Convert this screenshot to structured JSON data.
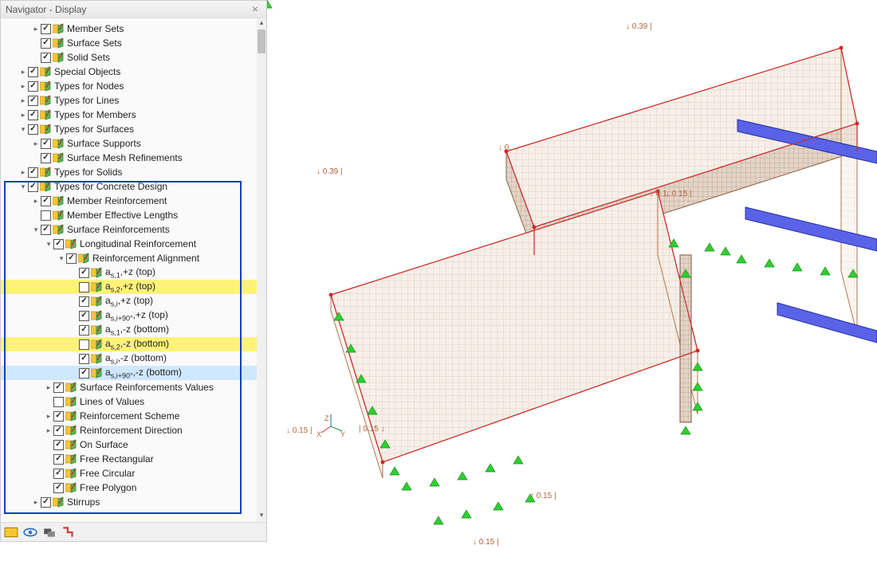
{
  "navigator": {
    "title": "Navigator - Display",
    "tree": [
      {
        "indent": 2,
        "chev": "r",
        "checked": true,
        "label": "Member Sets"
      },
      {
        "indent": 2,
        "chev": "",
        "checked": true,
        "label": "Surface Sets"
      },
      {
        "indent": 2,
        "chev": "",
        "checked": true,
        "label": "Solid Sets"
      },
      {
        "indent": 1,
        "chev": "r",
        "checked": true,
        "label": "Special Objects"
      },
      {
        "indent": 1,
        "chev": "r",
        "checked": true,
        "label": "Types for Nodes"
      },
      {
        "indent": 1,
        "chev": "r",
        "checked": true,
        "label": "Types for Lines"
      },
      {
        "indent": 1,
        "chev": "r",
        "checked": true,
        "label": "Types for Members"
      },
      {
        "indent": 1,
        "chev": "d",
        "checked": true,
        "label": "Types for Surfaces"
      },
      {
        "indent": 2,
        "chev": "r",
        "checked": true,
        "label": "Surface Supports"
      },
      {
        "indent": 2,
        "chev": "",
        "checked": true,
        "label": "Surface Mesh Refinements"
      },
      {
        "indent": 1,
        "chev": "r",
        "checked": true,
        "label": "Types for Solids"
      },
      {
        "indent": 1,
        "chev": "d",
        "checked": true,
        "label": "Types for Concrete Design"
      },
      {
        "indent": 2,
        "chev": "r",
        "checked": true,
        "label": "Member Reinforcement"
      },
      {
        "indent": 2,
        "chev": "",
        "checked": false,
        "label": "Member Effective Lengths"
      },
      {
        "indent": 2,
        "chev": "d",
        "checked": true,
        "label": "Surface Reinforcements"
      },
      {
        "indent": 3,
        "chev": "d",
        "checked": true,
        "label": "Longitudinal Reinforcement"
      },
      {
        "indent": 4,
        "chev": "d",
        "checked": true,
        "label": "Reinforcement Alignment"
      },
      {
        "indent": 5,
        "chev": "",
        "checked": true,
        "label": "a<sub>s,1</sub>,+z (top)"
      },
      {
        "indent": 5,
        "chev": "",
        "checked": false,
        "label": "a<sub>s,2</sub>,+z (top)",
        "hl": true
      },
      {
        "indent": 5,
        "chev": "",
        "checked": true,
        "label": "a<sub>s,i</sub>,+z (top)"
      },
      {
        "indent": 5,
        "chev": "",
        "checked": true,
        "label": "a<sub>s,i+90°</sub>,+z (top)"
      },
      {
        "indent": 5,
        "chev": "",
        "checked": true,
        "label": "a<sub>s,1</sub>,-z (bottom)"
      },
      {
        "indent": 5,
        "chev": "",
        "checked": false,
        "label": "a<sub>s,2</sub>,-z (bottom)",
        "hl": true
      },
      {
        "indent": 5,
        "chev": "",
        "checked": true,
        "label": "a<sub>s,i</sub>,-z (bottom)"
      },
      {
        "indent": 5,
        "chev": "",
        "checked": true,
        "label": "a<sub>s,i+90°</sub>,-z (bottom)",
        "sel": true
      },
      {
        "indent": 3,
        "chev": "r",
        "checked": true,
        "label": "Surface Reinforcements Values"
      },
      {
        "indent": 3,
        "chev": "",
        "checked": false,
        "label": "Lines of Values"
      },
      {
        "indent": 3,
        "chev": "r",
        "checked": true,
        "label": "Reinforcement Scheme"
      },
      {
        "indent": 3,
        "chev": "r",
        "checked": true,
        "label": "Reinforcement Direction"
      },
      {
        "indent": 3,
        "chev": "",
        "checked": true,
        "label": "On Surface"
      },
      {
        "indent": 3,
        "chev": "",
        "checked": true,
        "label": "Free Rectangular"
      },
      {
        "indent": 3,
        "chev": "",
        "checked": true,
        "label": "Free Circular"
      },
      {
        "indent": 3,
        "chev": "",
        "checked": true,
        "label": "Free Polygon"
      },
      {
        "indent": 2,
        "chev": "r",
        "checked": true,
        "label": "Stirrups"
      }
    ]
  },
  "dims": {
    "d039a": "↓ 0.39 |",
    "d039b": "↓ 0.39 |",
    "d01": "↓ 0.1…",
    "d015a": "↓ 0.15 |",
    "d015b": "| 0.15 ↓",
    "d015c": "↑ 0.15 |",
    "d015d": "↓ 0.15 |",
    "axes": "Z\nX  Y"
  }
}
